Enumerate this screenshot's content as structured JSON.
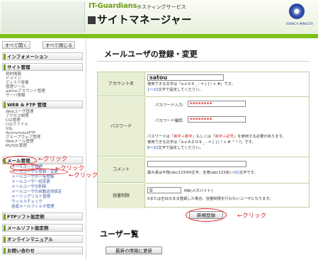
{
  "header": {
    "brand": "IT-Guardians",
    "brand_sub": "ホスティングサービス",
    "title": "サイトマネージャー",
    "corp": "KONICA MINOLTA"
  },
  "sidebar": {
    "expand_all": "すべて開く",
    "collapse_all": "すべて閉じる",
    "sections": [
      {
        "label": "インフォメーション"
      },
      {
        "label": "サイト管理",
        "items": [
          "契約情報",
          "ドメイン",
          "ディスク容量",
          "管理ツール",
          "adminアカウント管理",
          "サーバ情報"
        ]
      },
      {
        "label": "WEB & FTP 管理",
        "items": [
          "Webユーザ管理",
          "アクセス制限",
          "CGI管理",
          "CGIファイル",
          "SSL",
          "AnonymousFTP",
          "グループウェア管理",
          "Webメール管理",
          "MySQL管理"
        ]
      },
      {
        "label": "メール管理",
        "items": [
          "メールユーザ管理",
          "メールユーザの登録・変更",
          "メールユーザの一括登録",
          "メールユーザ一括変更",
          "メールユーザの削除",
          "メールユーザの自動返信設定",
          "メーリングリスト管理",
          "ウィルスチェック",
          "迷惑メールフィルタ管理"
        ]
      },
      {
        "label": "FTPソフト設定例"
      },
      {
        "label": "メールソフト設定例"
      },
      {
        "label": "オンラインマニュアル"
      },
      {
        "label": "お問い合わせ"
      }
    ]
  },
  "annotations": {
    "click1": "←クリック",
    "click2": "←クリック",
    "click3": "←クリック",
    "click4": "←クリック"
  },
  "main": {
    "heading": "メールユーザの登録・変更",
    "account_label": "アカウント名",
    "account_value": "satou",
    "account_note1": "使用できる文字は「a-z 0-9 _ - = | ] ! + #」です。",
    "account_note2_len": "1～32",
    "account_note2_rest": "文字で設定してください。",
    "password_label": "パスワード",
    "pw_input_label": "パスワード入力:",
    "pw_confirm_label": "パスワード確認:",
    "pw_mask": "********",
    "pw_note1_a": "パスワードは「",
    "pw_note1_b": "英字＋数字",
    "pw_note1_c": "」もしくは「",
    "pw_note1_d": "英字＋記号",
    "pw_note1_e": "」を使用する必要があります。",
    "pw_note2": "使用できる文字は「a-z A-Z 0-9 _ - = [ ] | ! + # ^ ! ?」です。",
    "pw_note3_len": "8～32",
    "pw_note3_rest": "文字で設定してください。",
    "comment_label": "コメント",
    "comment_note_a": "最大長は半角(abc123)64文字、全角(abc123あい)",
    "comment_note_b": "32",
    "comment_note_c": "文字です。",
    "quota_label": "容量制限",
    "quota_value": "0",
    "quota_unit": "MB(メガバイト)",
    "quota_note": "0または空白のまま登録した場合、容量制限を行わないユーザになります。",
    "register_button": "新規登録",
    "user_list_heading": "ユーザー覧",
    "refresh_button": "最新の情報に更新"
  }
}
